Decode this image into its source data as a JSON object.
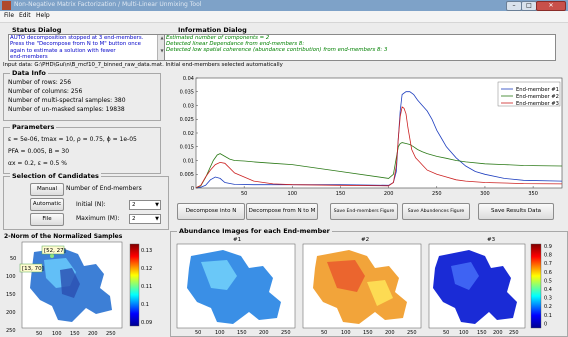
{
  "window": {
    "title": "Non-Negative Matrix Factorization / Multi-Linear Unmixing Tool",
    "minimize": "–",
    "maximize": "□",
    "close": "✕"
  },
  "menu": [
    "File",
    "Edit",
    "Help"
  ],
  "status_dialog": {
    "title": "Status Dialog",
    "lines": [
      "AUTO decomposition stopped at 3 end-members.",
      "Press the \"Decompose from N to M\" button once",
      "again to estimate a solution with fewer",
      "end-members"
    ]
  },
  "info_dialog": {
    "title": "Information Dialog",
    "lines": [
      "Estimated number of components = 2",
      "Detected linear Dependance from end-members 8:",
      "Detected low spatial coherence (abundance contribution) from end-members 8: 3"
    ]
  },
  "input_line": "Input data: G:\\PHD\\Gui\\n\\B_mcf10_7_binned_raw_data.mat. Initial end-members selected automatically",
  "data_info": {
    "title": "Data Info",
    "lines": [
      "Number of rows: 256",
      "Number of columns: 256",
      "Number of multi-spectral samples: 380",
      "Number of un-masked samples: 19838"
    ]
  },
  "parameters": {
    "title": "Parameters",
    "line1": "ε = 5e-06,  tmax = 10,  ρ = 0.75,  ϕ = 1e-05",
    "line2": "PFA = 0.005,  B = 30",
    "line3": "αx = 0.2,    ε = 0.5 %"
  },
  "candidates": {
    "title": "Selection of Candidates",
    "manual": "Manual",
    "automatic": "Automatic",
    "file": "File",
    "num_label": "Number of End-members",
    "initial_label": "Initial (N):",
    "initial_value": "2",
    "maximum_label": "Maximum (M):",
    "maximum_value": "2"
  },
  "buttons": {
    "decompose_n": "Decompose into N",
    "decompose_nm": "Decompose from N to M",
    "save_em": "Save End-members Figure",
    "save_ab": "Save Abundences Figure",
    "save_results": "Save Results Data"
  },
  "chart_data": {
    "type": "line",
    "title": "",
    "xlim": [
      0,
      380
    ],
    "ylim": [
      0,
      0.04
    ],
    "xticks": [
      50,
      100,
      150,
      200,
      250,
      300,
      350
    ],
    "yticks": [
      0,
      0.005,
      0.01,
      0.015,
      0.02,
      0.025,
      0.03,
      0.035,
      0.04
    ],
    "legend_position": "top-right",
    "series": [
      {
        "name": "End-member #1",
        "color": "#1f3fbf",
        "x": [
          0,
          5,
          10,
          15,
          20,
          25,
          30,
          40,
          60,
          100,
          150,
          200,
          205,
          208,
          210,
          212,
          214,
          218,
          222,
          226,
          230,
          235,
          240,
          245,
          250,
          255,
          260,
          270,
          280,
          290,
          300,
          320,
          340,
          380
        ],
        "y": [
          0.0001,
          0.0003,
          0.001,
          0.003,
          0.004,
          0.0035,
          0.002,
          0.0013,
          0.0012,
          0.0012,
          0.0012,
          0.001,
          0.002,
          0.006,
          0.018,
          0.028,
          0.034,
          0.035,
          0.035,
          0.034,
          0.032,
          0.03,
          0.028,
          0.025,
          0.021,
          0.018,
          0.015,
          0.011,
          0.008,
          0.006,
          0.005,
          0.0035,
          0.0028,
          0.0025
        ]
      },
      {
        "name": "End-member #2",
        "color": "#2c7a18",
        "x": [
          0,
          5,
          10,
          14,
          18,
          22,
          25,
          30,
          35,
          40,
          50,
          60,
          80,
          100,
          150,
          200,
          205,
          208,
          210,
          212,
          214,
          218,
          222,
          226,
          230,
          235,
          240,
          250,
          260,
          270,
          280,
          300,
          320,
          340,
          380
        ],
        "y": [
          0.0001,
          0.0008,
          0.0038,
          0.007,
          0.01,
          0.012,
          0.0125,
          0.0115,
          0.0105,
          0.01,
          0.0098,
          0.0095,
          0.009,
          0.0085,
          0.006,
          0.0035,
          0.005,
          0.011,
          0.015,
          0.0162,
          0.0165,
          0.0162,
          0.0158,
          0.015,
          0.014,
          0.0132,
          0.0125,
          0.0115,
          0.0108,
          0.01,
          0.0095,
          0.0088,
          0.0085,
          0.0082,
          0.008
        ]
      },
      {
        "name": "End-member #3",
        "color": "#cc2222",
        "x": [
          0,
          5,
          10,
          15,
          20,
          25,
          30,
          40,
          60,
          80,
          100,
          150,
          200,
          205,
          208,
          210,
          212,
          214,
          216,
          218,
          220,
          224,
          228,
          232,
          236,
          240,
          250,
          260,
          270,
          280,
          300,
          320,
          340,
          380
        ],
        "y": [
          0.0001,
          0.001,
          0.004,
          0.0065,
          0.0085,
          0.0093,
          0.009,
          0.0055,
          0.0025,
          0.0015,
          0.0012,
          0.001,
          0.0008,
          0.002,
          0.008,
          0.018,
          0.026,
          0.0295,
          0.029,
          0.027,
          0.022,
          0.014,
          0.011,
          0.0095,
          0.008,
          0.0065,
          0.005,
          0.004,
          0.003,
          0.0025,
          0.002,
          0.0018,
          0.0016,
          0.0015
        ]
      }
    ]
  },
  "norm_panel": {
    "title": "2-Norm of the Normalized Samples",
    "tip1": "[52, 27]",
    "tip2": "[13, 70]",
    "xticks": [
      "50",
      "100",
      "150",
      "200",
      "250"
    ],
    "yticks": [
      "50",
      "100",
      "150",
      "200",
      "250"
    ],
    "cbar_ticks": [
      "0.13",
      "0.12",
      "0.11",
      "0.1",
      "0.09"
    ]
  },
  "abundance_panel": {
    "title": "Abundance Images for each End-member",
    "subtitles": [
      "#1",
      "#2",
      "#3"
    ],
    "xticks": [
      "50",
      "100",
      "150",
      "200",
      "250"
    ],
    "cbar_ticks": [
      "0.9",
      "0.8",
      "0.7",
      "0.6",
      "0.5",
      "0.4",
      "0.3",
      "0.2",
      "0.1",
      "0"
    ]
  }
}
